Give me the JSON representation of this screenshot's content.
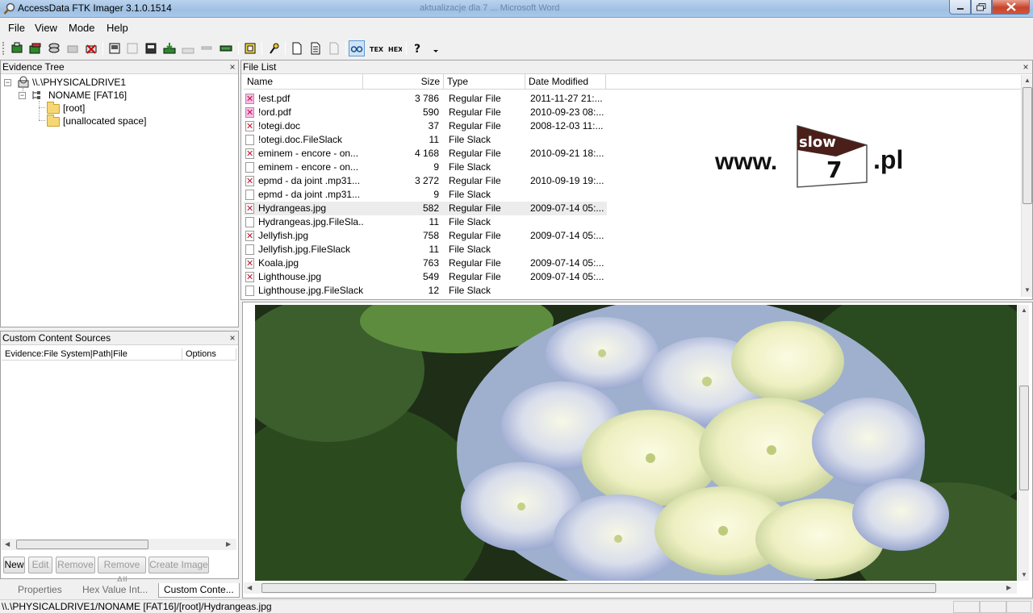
{
  "window": {
    "title": "AccessData FTK Imager 3.1.0.1514",
    "bg_title": "aktualizacje dla 7 ... Microsoft Word"
  },
  "menu": [
    "File",
    "View",
    "Mode",
    "Help"
  ],
  "evidence_tree": {
    "title": "Evidence Tree",
    "drive": "\\\\.\\PHYSICALDRIVE1",
    "partition": "NONAME [FAT16]",
    "children": [
      "[root]",
      "[unallocated space]"
    ]
  },
  "file_list": {
    "title": "File List",
    "columns": [
      "Name",
      "Size",
      "Type",
      "Date Modified"
    ],
    "rows": [
      {
        "name": "!est.pdf",
        "size": "3 786",
        "type": "Regular File",
        "date": "2011-11-27 21:...",
        "icon": "deleted-pdf"
      },
      {
        "name": "!ord.pdf",
        "size": "590",
        "type": "Regular File",
        "date": "2010-09-23 08:...",
        "icon": "deleted-pdf"
      },
      {
        "name": "!otegi.doc",
        "size": "37",
        "type": "Regular File",
        "date": "2008-12-03 11:...",
        "icon": "deleted-doc"
      },
      {
        "name": "!otegi.doc.FileSlack",
        "size": "11",
        "type": "File Slack",
        "date": "",
        "icon": "blank"
      },
      {
        "name": "eminem - encore - on...",
        "size": "4 168",
        "type": "Regular File",
        "date": "2010-09-21 18:...",
        "icon": "deleted"
      },
      {
        "name": "eminem - encore - on...",
        "size": "9",
        "type": "File Slack",
        "date": "",
        "icon": "blank"
      },
      {
        "name": "epmd - da joint .mp31...",
        "size": "3 272",
        "type": "Regular File",
        "date": "2010-09-19 19:...",
        "icon": "deleted"
      },
      {
        "name": "epmd - da joint .mp31...",
        "size": "9",
        "type": "File Slack",
        "date": "",
        "icon": "blank"
      },
      {
        "name": "Hydrangeas.jpg",
        "size": "582",
        "type": "Regular File",
        "date": "2009-07-14 05:...",
        "icon": "deleted-img"
      },
      {
        "name": "Hydrangeas.jpg.FileSla...",
        "size": "11",
        "type": "File Slack",
        "date": "",
        "icon": "blank"
      },
      {
        "name": "Jellyfish.jpg",
        "size": "758",
        "type": "Regular File",
        "date": "2009-07-14 05:...",
        "icon": "deleted-img"
      },
      {
        "name": "Jellyfish.jpg.FileSlack",
        "size": "11",
        "type": "File Slack",
        "date": "",
        "icon": "blank"
      },
      {
        "name": "Koala.jpg",
        "size": "763",
        "type": "Regular File",
        "date": "2009-07-14 05:...",
        "icon": "deleted-img"
      },
      {
        "name": "Lighthouse.jpg",
        "size": "549",
        "type": "Regular File",
        "date": "2009-07-14 05:...",
        "icon": "deleted-img"
      },
      {
        "name": "Lighthouse.jpg.FileSlack",
        "size": "12",
        "type": "File Slack",
        "date": "",
        "icon": "blank"
      }
    ],
    "selected_index": 8
  },
  "watermark": {
    "left": "www.",
    "box_top": "slow",
    "box_num": "7",
    "right": ".pl"
  },
  "custom_content": {
    "title": "Custom Content Sources",
    "columns": [
      "Evidence:File System|Path|File",
      "Options"
    ],
    "buttons": {
      "new": "New",
      "edit": "Edit",
      "remove": "Remove",
      "remove_all": "Remove All",
      "create_image": "Create Image"
    }
  },
  "bottom_tabs": [
    "Properties",
    "Hex Value Int...",
    "Custom Conte..."
  ],
  "status": {
    "path": "\\\\.\\PHYSICALDRIVE1/NONAME [FAT16]/[root]/Hydrangeas.jpg"
  },
  "colors": {
    "deleted_mark": "#c0142b",
    "titlebar": "#a9c8ea",
    "close_button": "#c7442b",
    "toolbar_active": "#cde3f7"
  }
}
